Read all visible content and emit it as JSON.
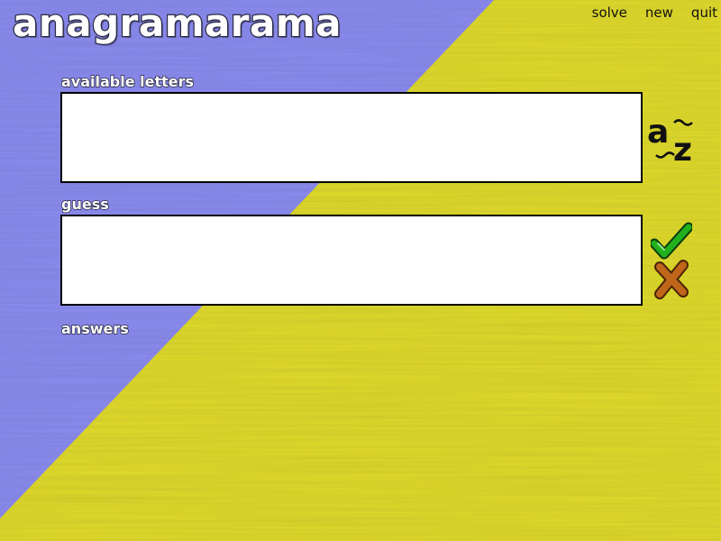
{
  "app": {
    "title": "anagramarama"
  },
  "menu": {
    "solve": "solve",
    "new": "new",
    "quit": "quit"
  },
  "sections": {
    "available_letters_label": "available letters",
    "guess_label": "guess",
    "answers_label": "answers"
  },
  "fields": {
    "available_letters_value": "",
    "guess_value": ""
  },
  "icons": {
    "shuffle": "shuffle-az-icon",
    "accept": "check-icon",
    "clear": "cross-icon"
  },
  "colors": {
    "background_blue": "#8c8cf0",
    "background_yellow": "#e0da2e",
    "box_fill": "#ffffff",
    "box_border": "#000000",
    "check_green": "#22b01e",
    "cross_orange": "#c0661a"
  }
}
